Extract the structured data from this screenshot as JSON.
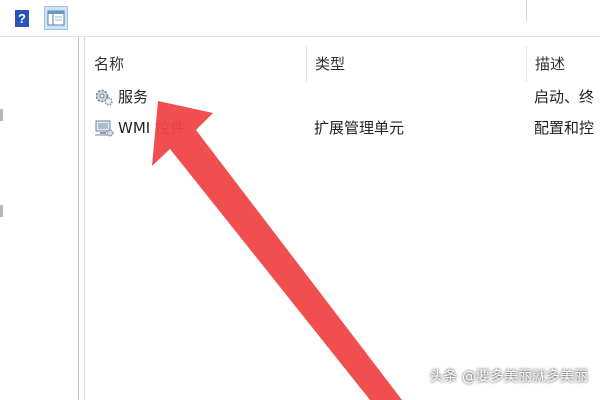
{
  "toolbar": {
    "help_icon": "help-icon",
    "help_glyph": "?",
    "view_icon": "console-view-icon"
  },
  "list": {
    "columns": [
      "名称",
      "类型",
      "描述"
    ],
    "rows": [
      {
        "icon": "services-gear-icon",
        "name": "服务",
        "type": "",
        "desc": "启动、终"
      },
      {
        "icon": "wmi-control-icon",
        "name": "WMI 控件",
        "type": "扩展管理单元",
        "desc": "配置和控"
      }
    ]
  },
  "annotation": {
    "arrow_color": "#f04646"
  },
  "watermark": {
    "text": "头条 @要多美丽就多美丽"
  }
}
